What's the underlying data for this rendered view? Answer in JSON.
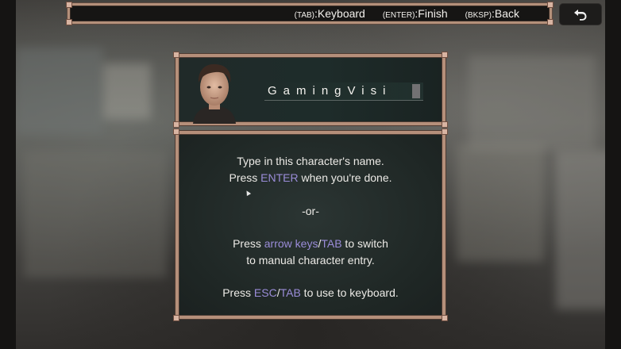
{
  "hint_bar": {
    "items": [
      {
        "key": "(TAB)",
        "action": ":Keyboard"
      },
      {
        "key": "(ENTER)",
        "action": ":Finish"
      },
      {
        "key": "(BKSP)",
        "action": ":Back"
      }
    ]
  },
  "back_button": {
    "icon": "undo-arrow-icon"
  },
  "name_entry": {
    "value": "GamingVisi",
    "portrait_icon": "character-portrait"
  },
  "instructions": {
    "line1": "Type in this character's name.",
    "line2_prefix": "Press ",
    "line2_key": "ENTER",
    "line2_suffix": " when you're done.",
    "separator": "-or-",
    "line4_prefix": "Press ",
    "line4_key1": "arrow keys",
    "line4_slash": "/",
    "line4_key2": "TAB",
    "line4_suffix": " to switch",
    "line5": "to manual character entry.",
    "line6_prefix": "Press ",
    "line6_key1": "ESC",
    "line6_slash": "/",
    "line6_key2": "TAB",
    "line6_suffix": " to use to keyboard."
  },
  "colors": {
    "frame": "#b58f7a",
    "highlight": "#9a8cd8",
    "panel": "#1f2725"
  }
}
